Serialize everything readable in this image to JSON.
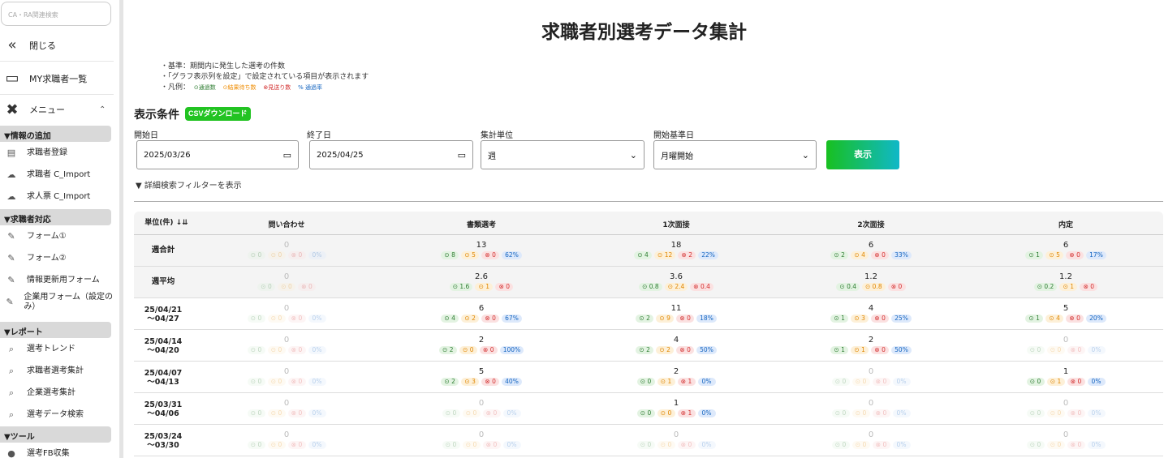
{
  "sidebar": {
    "search_placeholder": "CA・RA関連検索",
    "close_label": "閉じる",
    "my_list_label": "MY求職者一覧",
    "menu_label": "メニュー",
    "sections": [
      {
        "title": "▼情報の追加",
        "items": [
          {
            "label": "求職者登録",
            "icon": "id-card-icon"
          },
          {
            "label": "求職者 C_Import",
            "icon": "cloud-upload-icon"
          },
          {
            "label": "求人票 C_Import",
            "icon": "cloud-upload-icon"
          }
        ]
      },
      {
        "title": "▼求職者対応",
        "items": [
          {
            "label": "フォーム①",
            "icon": "form-icon"
          },
          {
            "label": "フォーム②",
            "icon": "form-icon"
          },
          {
            "label": "情報更新用フォーム",
            "icon": "form-icon"
          },
          {
            "label": "企業用フォーム（設定のみ）",
            "icon": "form-icon"
          }
        ]
      },
      {
        "title": "▼レポート",
        "items": [
          {
            "label": "選考トレンド",
            "icon": "search-icon"
          },
          {
            "label": "求職者選考集計",
            "icon": "search-icon"
          },
          {
            "label": "企業選考集計",
            "icon": "search-icon"
          },
          {
            "label": "選考データ検索",
            "icon": "search-icon"
          }
        ]
      },
      {
        "title": "▼ツール",
        "items": [
          {
            "label": "選考FB収集",
            "icon": "chat-icon"
          }
        ]
      }
    ]
  },
  "page": {
    "title": "求職者別選考データ集計",
    "note1": "・基準：期間内に発生した選考の件数",
    "note2": "・「グラフ表示列を設定」で設定されている項目が表示されます",
    "note3_prefix": "・凡例：",
    "legend": {
      "pass": "⊙通過数",
      "wait": "⊙結果待ち数",
      "reject": "⊗見送り数",
      "rate": "% 通過率"
    }
  },
  "conditions": {
    "title": "表示条件",
    "csv_label": "CSVダウンロード",
    "start_label": "開始日",
    "start_value": "2025/03/26",
    "end_label": "終了日",
    "end_value": "2025/04/25",
    "unit_label": "集計単位",
    "unit_value": "週",
    "base_label": "開始基準日",
    "base_value": "月曜開始",
    "show_label": "表示",
    "filter_link": "▼ 詳細検索フィルターを表示"
  },
  "table": {
    "unit_header": "単位(件) ↓⇊",
    "columns": [
      "問い合わせ",
      "書類選考",
      "1次面接",
      "2次面接",
      "内定"
    ],
    "rows": [
      {
        "label": "週合計",
        "cells": [
          {
            "total": "0",
            "chips": [
              "0",
              "0",
              "0",
              "0%"
            ]
          },
          {
            "total": "13",
            "chips": [
              "8",
              "5",
              "0",
              "62%"
            ]
          },
          {
            "total": "18",
            "chips": [
              "4",
              "12",
              "2",
              "22%"
            ]
          },
          {
            "total": "6",
            "chips": [
              "2",
              "4",
              "0",
              "33%"
            ]
          },
          {
            "total": "6",
            "chips": [
              "1",
              "5",
              "0",
              "17%"
            ]
          }
        ]
      },
      {
        "label": "週平均",
        "cells": [
          {
            "total": "0",
            "chips": [
              "0",
              "0",
              "0"
            ]
          },
          {
            "total": "2.6",
            "chips": [
              "1.6",
              "1",
              "0"
            ]
          },
          {
            "total": "3.6",
            "chips": [
              "0.8",
              "2.4",
              "0.4"
            ]
          },
          {
            "total": "1.2",
            "chips": [
              "0.4",
              "0.8",
              "0"
            ]
          },
          {
            "total": "1.2",
            "chips": [
              "0.2",
              "1",
              "0"
            ]
          }
        ]
      },
      {
        "label": "25/04/21\n～04/27",
        "cells": [
          {
            "total": "0",
            "chips": [
              "0",
              "0",
              "0",
              "0%"
            ]
          },
          {
            "total": "6",
            "chips": [
              "4",
              "2",
              "0",
              "67%"
            ]
          },
          {
            "total": "11",
            "chips": [
              "2",
              "9",
              "0",
              "18%"
            ]
          },
          {
            "total": "4",
            "chips": [
              "1",
              "3",
              "0",
              "25%"
            ]
          },
          {
            "total": "5",
            "chips": [
              "1",
              "4",
              "0",
              "20%"
            ]
          }
        ]
      },
      {
        "label": "25/04/14\n～04/20",
        "cells": [
          {
            "total": "0",
            "chips": [
              "0",
              "0",
              "0",
              "0%"
            ]
          },
          {
            "total": "2",
            "chips": [
              "2",
              "0",
              "0",
              "100%"
            ]
          },
          {
            "total": "4",
            "chips": [
              "2",
              "2",
              "0",
              "50%"
            ]
          },
          {
            "total": "2",
            "chips": [
              "1",
              "1",
              "0",
              "50%"
            ]
          },
          {
            "total": "0",
            "chips": [
              "0",
              "0",
              "0",
              "0%"
            ]
          }
        ]
      },
      {
        "label": "25/04/07\n～04/13",
        "cells": [
          {
            "total": "0",
            "chips": [
              "0",
              "0",
              "0",
              "0%"
            ]
          },
          {
            "total": "5",
            "chips": [
              "2",
              "3",
              "0",
              "40%"
            ]
          },
          {
            "total": "2",
            "chips": [
              "0",
              "1",
              "1",
              "0%"
            ]
          },
          {
            "total": "0",
            "chips": [
              "0",
              "0",
              "0",
              "0%"
            ]
          },
          {
            "total": "1",
            "chips": [
              "0",
              "1",
              "0",
              "0%"
            ]
          }
        ]
      },
      {
        "label": "25/03/31\n～04/06",
        "cells": [
          {
            "total": "0",
            "chips": [
              "0",
              "0",
              "0",
              "0%"
            ]
          },
          {
            "total": "0",
            "chips": [
              "0",
              "0",
              "0",
              "0%"
            ]
          },
          {
            "total": "1",
            "chips": [
              "0",
              "0",
              "1",
              "0%"
            ]
          },
          {
            "total": "0",
            "chips": [
              "0",
              "0",
              "0",
              "0%"
            ]
          },
          {
            "total": "0",
            "chips": [
              "0",
              "0",
              "0",
              "0%"
            ]
          }
        ]
      },
      {
        "label": "25/03/24\n～03/30",
        "cells": [
          {
            "total": "0",
            "chips": [
              "0",
              "0",
              "0",
              "0%"
            ]
          },
          {
            "total": "0",
            "chips": [
              "0",
              "0",
              "0",
              "0%"
            ]
          },
          {
            "total": "0",
            "chips": [
              "0",
              "0",
              "0",
              "0%"
            ]
          },
          {
            "total": "0",
            "chips": [
              "0",
              "0",
              "0",
              "0%"
            ]
          },
          {
            "total": "0",
            "chips": [
              "0",
              "0",
              "0",
              "0%"
            ]
          }
        ]
      }
    ]
  }
}
